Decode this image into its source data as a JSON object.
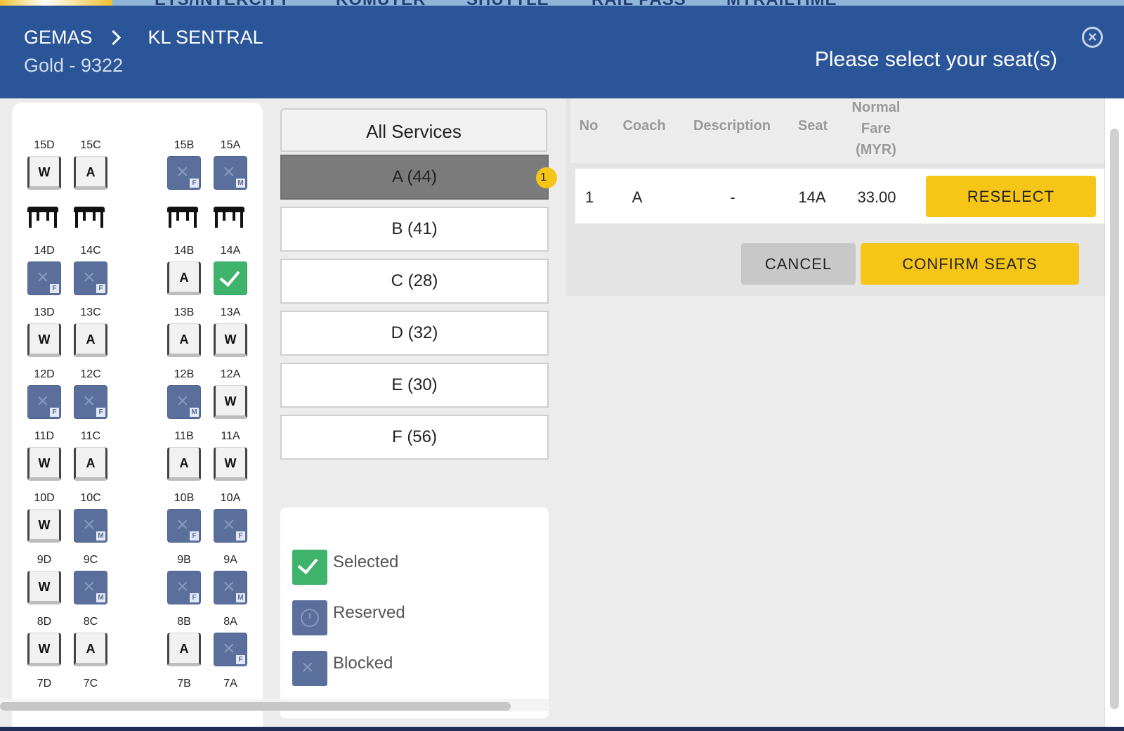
{
  "site_nav": {
    "items": [
      "ETS/INTERCITY",
      "KOMUTER",
      "SHUTTLE",
      "RAIL PASS",
      "MYRAILTIME"
    ]
  },
  "header": {
    "origin": "GEMAS",
    "destination": "KL SENTRAL",
    "train": "Gold - 9322",
    "prompt": "Please select your seat(s)",
    "close_icon": "close-circle-icon"
  },
  "seat_map": {
    "columns_left": [
      "D",
      "C"
    ],
    "columns_right": [
      "B",
      "A"
    ],
    "row_15": [
      {
        "label": "15D",
        "state": "available",
        "text": "W"
      },
      {
        "label": "15C",
        "state": "available",
        "text": "A"
      },
      {
        "label": "15B",
        "state": "blocked",
        "tag": "F"
      },
      {
        "label": "15A",
        "state": "blocked",
        "tag": "M"
      }
    ],
    "row_14": [
      {
        "label": "14D",
        "state": "blocked",
        "tag": "F"
      },
      {
        "label": "14C",
        "state": "blocked",
        "tag": "F"
      },
      {
        "label": "14B",
        "state": "available",
        "text": "A"
      },
      {
        "label": "14A",
        "state": "selected"
      }
    ],
    "row_13": [
      {
        "label": "13D",
        "state": "available",
        "text": "W"
      },
      {
        "label": "13C",
        "state": "available",
        "text": "A"
      },
      {
        "label": "13B",
        "state": "available",
        "text": "A"
      },
      {
        "label": "13A",
        "state": "available",
        "text": "W"
      }
    ],
    "row_12": [
      {
        "label": "12D",
        "state": "blocked",
        "tag": "F"
      },
      {
        "label": "12C",
        "state": "blocked",
        "tag": "F"
      },
      {
        "label": "12B",
        "state": "blocked",
        "tag": "M"
      },
      {
        "label": "12A",
        "state": "available",
        "text": "W"
      }
    ],
    "row_11": [
      {
        "label": "11D",
        "state": "available",
        "text": "W"
      },
      {
        "label": "11C",
        "state": "available",
        "text": "A"
      },
      {
        "label": "11B",
        "state": "available",
        "text": "A"
      },
      {
        "label": "11A",
        "state": "available",
        "text": "W"
      }
    ],
    "row_10": [
      {
        "label": "10D",
        "state": "available",
        "text": "W"
      },
      {
        "label": "10C",
        "state": "blocked",
        "tag": "M"
      },
      {
        "label": "10B",
        "state": "blocked",
        "tag": "F"
      },
      {
        "label": "10A",
        "state": "blocked",
        "tag": "F"
      }
    ],
    "row_9": [
      {
        "label": "9D",
        "state": "available",
        "text": "W"
      },
      {
        "label": "9C",
        "state": "blocked",
        "tag": "M"
      },
      {
        "label": "9B",
        "state": "blocked",
        "tag": "F"
      },
      {
        "label": "9A",
        "state": "blocked",
        "tag": "M"
      }
    ],
    "row_8": [
      {
        "label": "8D",
        "state": "available",
        "text": "W"
      },
      {
        "label": "8C",
        "state": "available",
        "text": "A"
      },
      {
        "label": "8B",
        "state": "available",
        "text": "A"
      },
      {
        "label": "8A",
        "state": "blocked",
        "tag": "F"
      }
    ],
    "row_7_labels": [
      "7D",
      "7C",
      "7B",
      "7A"
    ]
  },
  "coaches": {
    "header": "All Services",
    "items": [
      {
        "label": "A (44)",
        "active": true,
        "badge": "1"
      },
      {
        "label": "B (41)"
      },
      {
        "label": "C (28)"
      },
      {
        "label": "D (32)"
      },
      {
        "label": "E (30)"
      },
      {
        "label": "F (56)"
      }
    ]
  },
  "legend": {
    "selected": "Selected",
    "reserved": "Reserved",
    "blocked": "Blocked"
  },
  "summary": {
    "columns": {
      "no": "No",
      "coach": "Coach",
      "description": "Description",
      "seat": "Seat",
      "fare_line1": "Normal",
      "fare_line2": "Fare",
      "fare_line3": "(MYR)"
    },
    "rows": [
      {
        "no": "1",
        "coach": "A",
        "description": "-",
        "seat": "14A",
        "fare": "33.00",
        "action": "RESELECT"
      }
    ]
  },
  "actions": {
    "cancel": "CANCEL",
    "confirm": "CONFIRM SEATS"
  },
  "colors": {
    "header_bg": "#2b5599",
    "selected": "#3fb26b",
    "blocked": "#5a6f9c",
    "accent": "#f5c518"
  }
}
